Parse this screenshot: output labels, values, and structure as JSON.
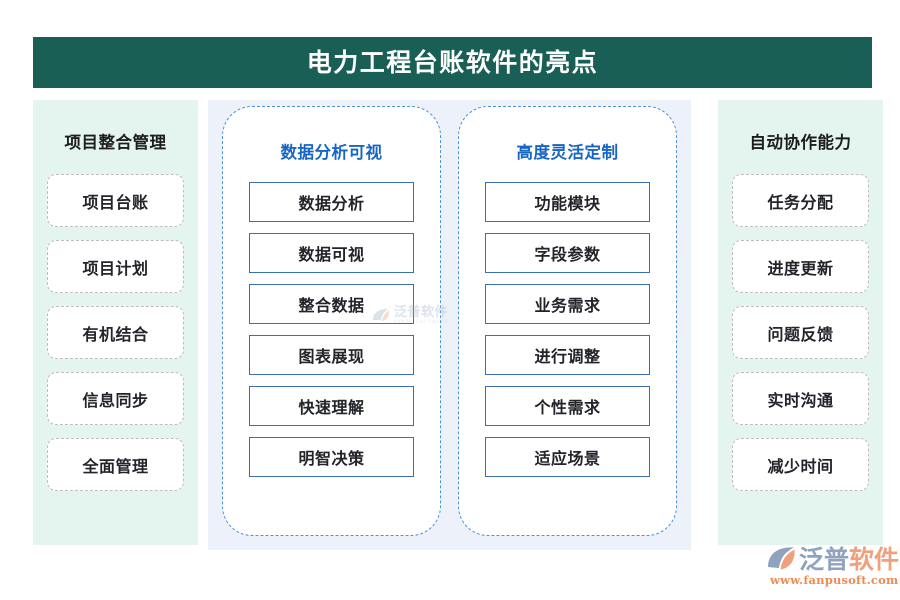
{
  "header": {
    "title": "电力工程台账软件的亮点",
    "bg_color": "#1a5f56"
  },
  "columns": {
    "left": {
      "heading": "项目整合管理",
      "bg_color": "#e4f4ef",
      "items": [
        {
          "label": "项目台账"
        },
        {
          "label": "项目计划"
        },
        {
          "label": "有机结合"
        },
        {
          "label": "信息同步"
        },
        {
          "label": "全面管理"
        }
      ]
    },
    "middle": [
      {
        "heading": "数据分析可视",
        "heading_color": "#1866c4",
        "items": [
          {
            "label": "数据分析"
          },
          {
            "label": "数据可视"
          },
          {
            "label": "整合数据"
          },
          {
            "label": "图表展现"
          },
          {
            "label": "快速理解"
          },
          {
            "label": "明智决策"
          }
        ]
      },
      {
        "heading": "高度灵活定制",
        "heading_color": "#1866c4",
        "items": [
          {
            "label": "功能模块"
          },
          {
            "label": "字段参数"
          },
          {
            "label": "业务需求"
          },
          {
            "label": "进行调整"
          },
          {
            "label": "个性需求"
          },
          {
            "label": "适应场景"
          }
        ]
      }
    ],
    "right": {
      "heading": "自动协作能力",
      "bg_color": "#e4f4ef",
      "items": [
        {
          "label": "任务分配"
        },
        {
          "label": "进度更新"
        },
        {
          "label": "问题反馈"
        },
        {
          "label": "实时沟通"
        },
        {
          "label": "减少时间"
        }
      ]
    }
  },
  "watermark": {
    "cn": "泛普软件",
    "en": "FANPU SOFTWARE"
  },
  "brand": {
    "name_part1": "泛普",
    "name_part2": "软件",
    "url": "www.fanpusoft.com",
    "accent_color": "#ef8b55",
    "icon_color": "#8fa3bd"
  }
}
